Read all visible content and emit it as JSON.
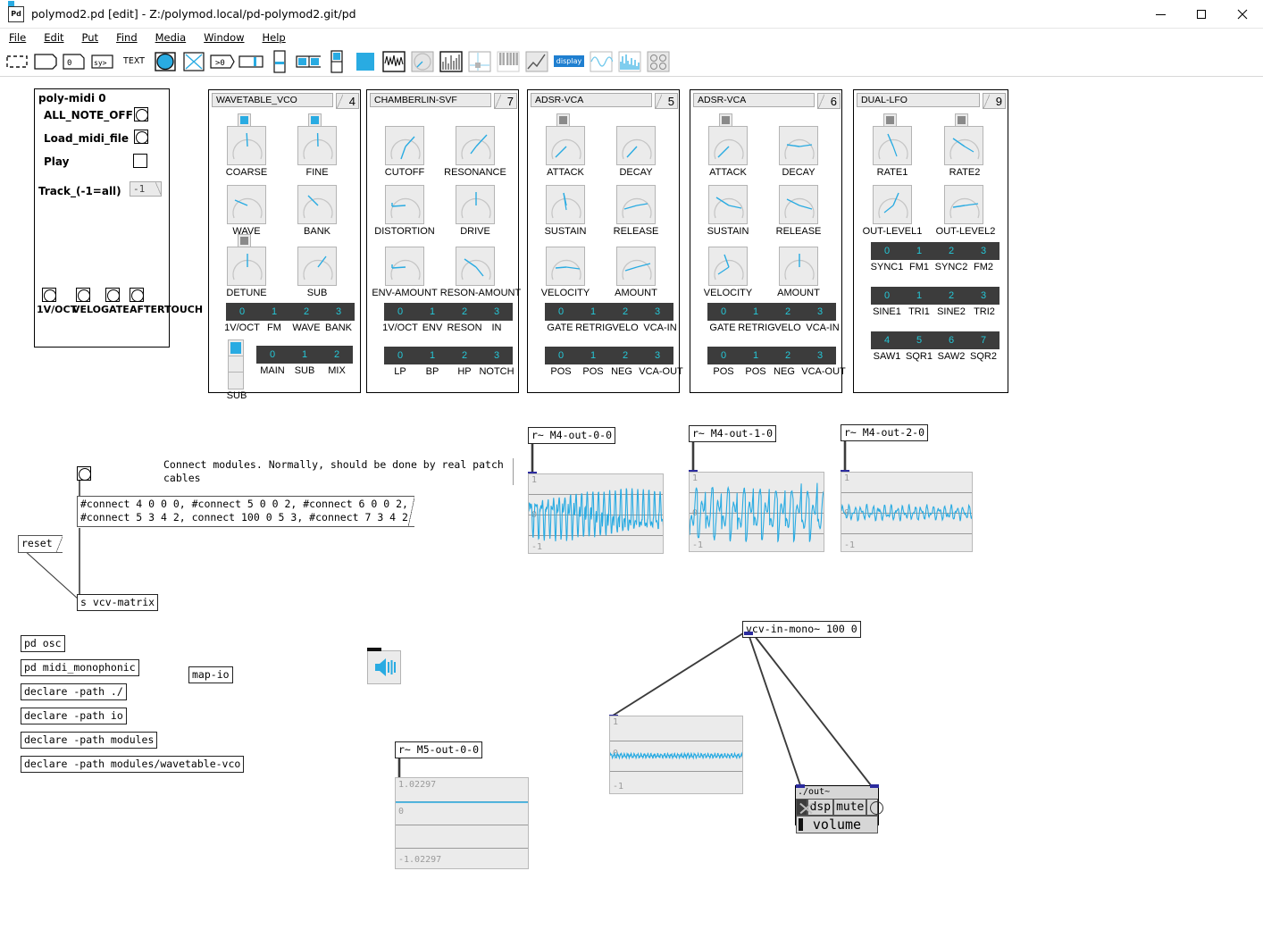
{
  "window": {
    "title": "polymod2.pd  [edit] - Z:/polymod.local/pd-polymod2.git/pd",
    "app_icon": "pd-icon",
    "minimize": "—",
    "maximize": "□",
    "close": "✕"
  },
  "menu": [
    {
      "label": "File"
    },
    {
      "label": "Edit"
    },
    {
      "label": "Put"
    },
    {
      "label": "Find"
    },
    {
      "label": "Media"
    },
    {
      "label": "Window"
    },
    {
      "label": "Help"
    }
  ],
  "toolbar": [
    {
      "name": "selection-tool-icon",
      "label": ""
    },
    {
      "name": "object-box-icon",
      "label": ""
    },
    {
      "name": "message-box-icon",
      "label": "0"
    },
    {
      "name": "symbol-box-icon",
      "label": "sy>"
    },
    {
      "name": "comment-icon",
      "label": "TEXT"
    },
    {
      "name": "bang-icon",
      "label": ""
    },
    {
      "name": "toggle-icon",
      "label": ""
    },
    {
      "name": "number2-icon",
      "label": ">0"
    },
    {
      "name": "hslider-icon",
      "label": ""
    },
    {
      "name": "vslider-icon",
      "label": ""
    },
    {
      "name": "hradio-icon",
      "label": ""
    },
    {
      "name": "vradio-icon",
      "label": ""
    },
    {
      "name": "canvas-icon",
      "label": ""
    },
    {
      "name": "signal-graph-icon",
      "label": ""
    },
    {
      "name": "knob-icon",
      "label": ""
    },
    {
      "name": "vu-meter-icon",
      "label": ""
    },
    {
      "name": "xy-pad-icon",
      "label": ""
    },
    {
      "name": "keyboard-icon",
      "label": ""
    },
    {
      "name": "envelope-icon",
      "label": ""
    },
    {
      "name": "display-icon",
      "label": "display"
    },
    {
      "name": "scope-icon",
      "label": ""
    },
    {
      "name": "spectrum-icon",
      "label": ""
    },
    {
      "name": "pad-icon",
      "label": ""
    }
  ],
  "poly_midi": {
    "title": "poly-midi 0",
    "rows": [
      {
        "label": "ALL_NOTE_OFF",
        "widget": "bang"
      },
      {
        "label": "Load_midi_file",
        "widget": "bang"
      },
      {
        "label": "Play",
        "widget": "toggle"
      }
    ],
    "track_label": "Track_(-1=all)",
    "track_value": "-1",
    "outlets": [
      {
        "label": "1V/OCT"
      },
      {
        "label": "VELO"
      },
      {
        "label": "GATE"
      },
      {
        "label": "AFTERTOUCH"
      }
    ]
  },
  "modules": [
    {
      "id": "wavetable-vco",
      "title": "WAVETABLE_VCO",
      "number": "4",
      "knobs": [
        {
          "label": "COARSE",
          "angle": -0.05,
          "toggle": "on"
        },
        {
          "label": "FINE",
          "angle": -0.02,
          "toggle": "on"
        },
        {
          "label": "WAVE",
          "angle": -1.95,
          "toggle": null
        },
        {
          "label": "BANK",
          "angle": -2.25,
          "toggle": null
        },
        {
          "label": "DETUNE",
          "angle": 0.0,
          "toggle": "off"
        },
        {
          "label": "SUB",
          "angle": 0.62,
          "toggle": null
        }
      ],
      "inlets_row1": [
        {
          "index": "0",
          "label": "1V/OCT"
        },
        {
          "index": "1",
          "label": "FM"
        },
        {
          "index": "2",
          "label": "WAVE"
        },
        {
          "index": "3",
          "label": "BANK"
        }
      ],
      "outlets_row2": [
        {
          "index": "0",
          "label": "MAIN"
        },
        {
          "index": "1",
          "label": "SUB"
        },
        {
          "index": "2",
          "label": "MIX"
        }
      ],
      "vradio": {
        "label": "SUB",
        "count": 3,
        "selected": 0
      }
    },
    {
      "id": "chamberlin-svf",
      "title": "CHAMBERLIN-SVF",
      "number": "7",
      "knobs": [
        {
          "label": "CUTOFF",
          "angle": -0.7,
          "toggle": null
        },
        {
          "label": "RESONANCE",
          "angle": -1.05,
          "toggle": null
        },
        {
          "label": "DISTORTION",
          "angle": -2.62,
          "toggle": null
        },
        {
          "label": "DRIVE",
          "angle": -0.04,
          "toggle": null
        },
        {
          "label": "ENV-AMOUNT",
          "angle": -2.62,
          "toggle": null
        },
        {
          "label": "RESON-AMOUNT",
          "angle": -2.1,
          "toggle": null
        }
      ],
      "inlets_row1": [
        {
          "index": "0",
          "label": "1V/OCT"
        },
        {
          "index": "1",
          "label": "ENV"
        },
        {
          "index": "2",
          "label": "RESON"
        },
        {
          "index": "3",
          "label": "IN"
        }
      ],
      "outlets_row2": [
        {
          "index": "0",
          "label": "LP"
        },
        {
          "index": "1",
          "label": "BP"
        },
        {
          "index": "2",
          "label": "HP"
        },
        {
          "index": "3",
          "label": "NOTCH"
        }
      ]
    },
    {
      "id": "adsr-vca-5",
      "title": "ADSR-VCA",
      "number": "5",
      "knobs": [
        {
          "label": "ATTACK",
          "angle": -2.35,
          "toggle": "off"
        },
        {
          "label": "DECAY",
          "angle": -2.3,
          "toggle": null
        },
        {
          "label": "SUSTAIN",
          "angle": -0.22,
          "toggle": null
        },
        {
          "label": "RELEASE",
          "angle": -2.45,
          "toggle": null
        },
        {
          "label": "VELOCITY",
          "angle": -1.66,
          "toggle": null
        },
        {
          "label": "AMOUNT",
          "angle": -1.5,
          "toggle": null
        }
      ],
      "inlets_row1": [
        {
          "index": "0",
          "label": "GATE"
        },
        {
          "index": "1",
          "label": "RETRIG"
        },
        {
          "index": "2",
          "label": "VELO"
        },
        {
          "index": "3",
          "label": "VCA-IN"
        }
      ],
      "outlets_row2": [
        {
          "index": "0",
          "label": "POS"
        },
        {
          "index": "1",
          "label": "POS"
        },
        {
          "index": "2",
          "label": "NEG"
        },
        {
          "index": "3",
          "label": "VCA-OUT"
        }
      ]
    },
    {
      "id": "adsr-vca-6",
      "title": "ADSR-VCA",
      "number": "6",
      "knobs": [
        {
          "label": "ATTACK",
          "angle": -2.3,
          "toggle": "off"
        },
        {
          "label": "DECAY",
          "angle": -1.6,
          "toggle": null
        },
        {
          "label": "SUSTAIN",
          "angle": -2.05,
          "toggle": null
        },
        {
          "label": "RELEASE",
          "angle": -1.8,
          "toggle": null
        },
        {
          "label": "VELOCITY",
          "angle": -2.4,
          "toggle": null
        },
        {
          "label": "AMOUNT",
          "angle": 0.0,
          "toggle": null
        }
      ],
      "inlets_row1": [
        {
          "index": "0",
          "label": "GATE"
        },
        {
          "index": "1",
          "label": "RETRIG"
        },
        {
          "index": "2",
          "label": "VELO"
        },
        {
          "index": "3",
          "label": "VCA-IN"
        }
      ],
      "outlets_row2": [
        {
          "index": "0",
          "label": "POS"
        },
        {
          "index": "1",
          "label": "POS"
        },
        {
          "index": "2",
          "label": "NEG"
        },
        {
          "index": "3",
          "label": "VCA-OUT"
        }
      ]
    },
    {
      "id": "dual-lfo",
      "title": "DUAL-LFO",
      "number": "9",
      "knobs": [
        {
          "label": "RATE1",
          "angle": -2.5,
          "toggle": "off"
        },
        {
          "label": "RATE2",
          "angle": -2.2,
          "toggle": "off"
        },
        {
          "label": "OUT-LEVEL1",
          "angle": -2.7,
          "toggle": null
        },
        {
          "label": "OUT-LEVEL2",
          "angle": -1.45,
          "toggle": null
        }
      ],
      "inlets_row1": [
        {
          "index": "0",
          "label": "SYNC1"
        },
        {
          "index": "1",
          "label": "FM1"
        },
        {
          "index": "2",
          "label": "SYNC2"
        },
        {
          "index": "3",
          "label": "FM2"
        }
      ],
      "outlets_row2": [
        {
          "index": "0",
          "label": "SINE1"
        },
        {
          "index": "1",
          "label": "TRI1"
        },
        {
          "index": "2",
          "label": "SINE2"
        },
        {
          "index": "3",
          "label": "TRI2"
        }
      ],
      "outlets_row3": [
        {
          "index": "4",
          "label": "SAW1"
        },
        {
          "index": "5",
          "label": "SQR1"
        },
        {
          "index": "6",
          "label": "SAW2"
        },
        {
          "index": "7",
          "label": "SQR2"
        }
      ]
    }
  ],
  "patch": {
    "comment_connect": "Connect modules. Normally, should be done by real patch\ncables",
    "connect_message": "#connect 4 0 0 0, #connect 5 0 0 2, #connect 6 0 0 2,\n#connect 5 3 4 2, connect 100 0 5 3, #connect 7 3 4 2",
    "reset_message": "reset",
    "send_object": "s vcv-matrix",
    "objects": [
      {
        "name": "pd-osc",
        "text": "pd osc"
      },
      {
        "name": "pd-midi-monophonic",
        "text": "pd midi_monophonic"
      },
      {
        "name": "declare-path-dot",
        "text": "declare -path ./"
      },
      {
        "name": "declare-path-io",
        "text": "declare -path io"
      },
      {
        "name": "declare-path-modules",
        "text": "declare -path modules"
      },
      {
        "name": "declare-path-wavetable-vco",
        "text": "declare -path modules/wavetable-vco"
      }
    ],
    "map_io": "map-io",
    "vcv_in_mono": "vcv-in-mono~ 100 0",
    "out_abstraction": {
      "title": "./out~",
      "dsp_label": "dsp",
      "mute_label": "mute",
      "volume_label": "volume"
    }
  },
  "chart_data": [
    {
      "type": "line",
      "name": "scope-m4-out-0-0",
      "title": "r~ M4-out-0-0",
      "ylabels": [
        "1",
        "0",
        "-1"
      ],
      "ylim": [
        -1,
        1
      ],
      "grid": true,
      "trace_color": "#29abe2",
      "waveform": "dense-saw-cluster",
      "cycles": 24,
      "amplitude": 0.95
    },
    {
      "type": "line",
      "name": "scope-m4-out-1-0",
      "title": "r~ M4-out-1-0",
      "ylabels": [
        "1",
        "0",
        "-1"
      ],
      "ylim": [
        -1,
        1
      ],
      "grid": true,
      "trace_color": "#29abe2",
      "waveform": "saw-cluster",
      "cycles": 17,
      "amplitude": 0.92
    },
    {
      "type": "line",
      "name": "scope-m4-out-2-0",
      "title": "r~ M4-out-2-0",
      "ylabels": [
        "1",
        "0",
        "-1"
      ],
      "ylim": [
        -1,
        1
      ],
      "grid": true,
      "trace_color": "#29abe2",
      "waveform": "medium-noise",
      "cycles": 22,
      "amplitude": 0.42
    },
    {
      "type": "line",
      "name": "scope-m5-out-0-0",
      "title": "r~ M5-out-0-0",
      "ylabels": [
        "1.02297",
        "0",
        "-1.02297"
      ],
      "ylim": [
        -1.02297,
        1.02297
      ],
      "grid": true,
      "trace_color": "#29abe2",
      "waveform": "flat-near-top",
      "cycles": 0,
      "amplitude": 0.0
    },
    {
      "type": "line",
      "name": "scope-vcv-in-mono",
      "title": "",
      "ylabels": [
        "1",
        "0",
        "-1"
      ],
      "ylim": [
        -1,
        1
      ],
      "grid": true,
      "trace_color": "#29abe2",
      "waveform": "low-amplitude-ripple",
      "cycles": 40,
      "amplitude": 0.12
    }
  ],
  "colors": {
    "accent": "#29abe2",
    "cell_bg": "#3c3c3c",
    "cell_text": "#24c8d8",
    "panel_bg": "#ebebeb",
    "panel_border": "#b4b4b4",
    "cord": "#3b3b3b"
  }
}
